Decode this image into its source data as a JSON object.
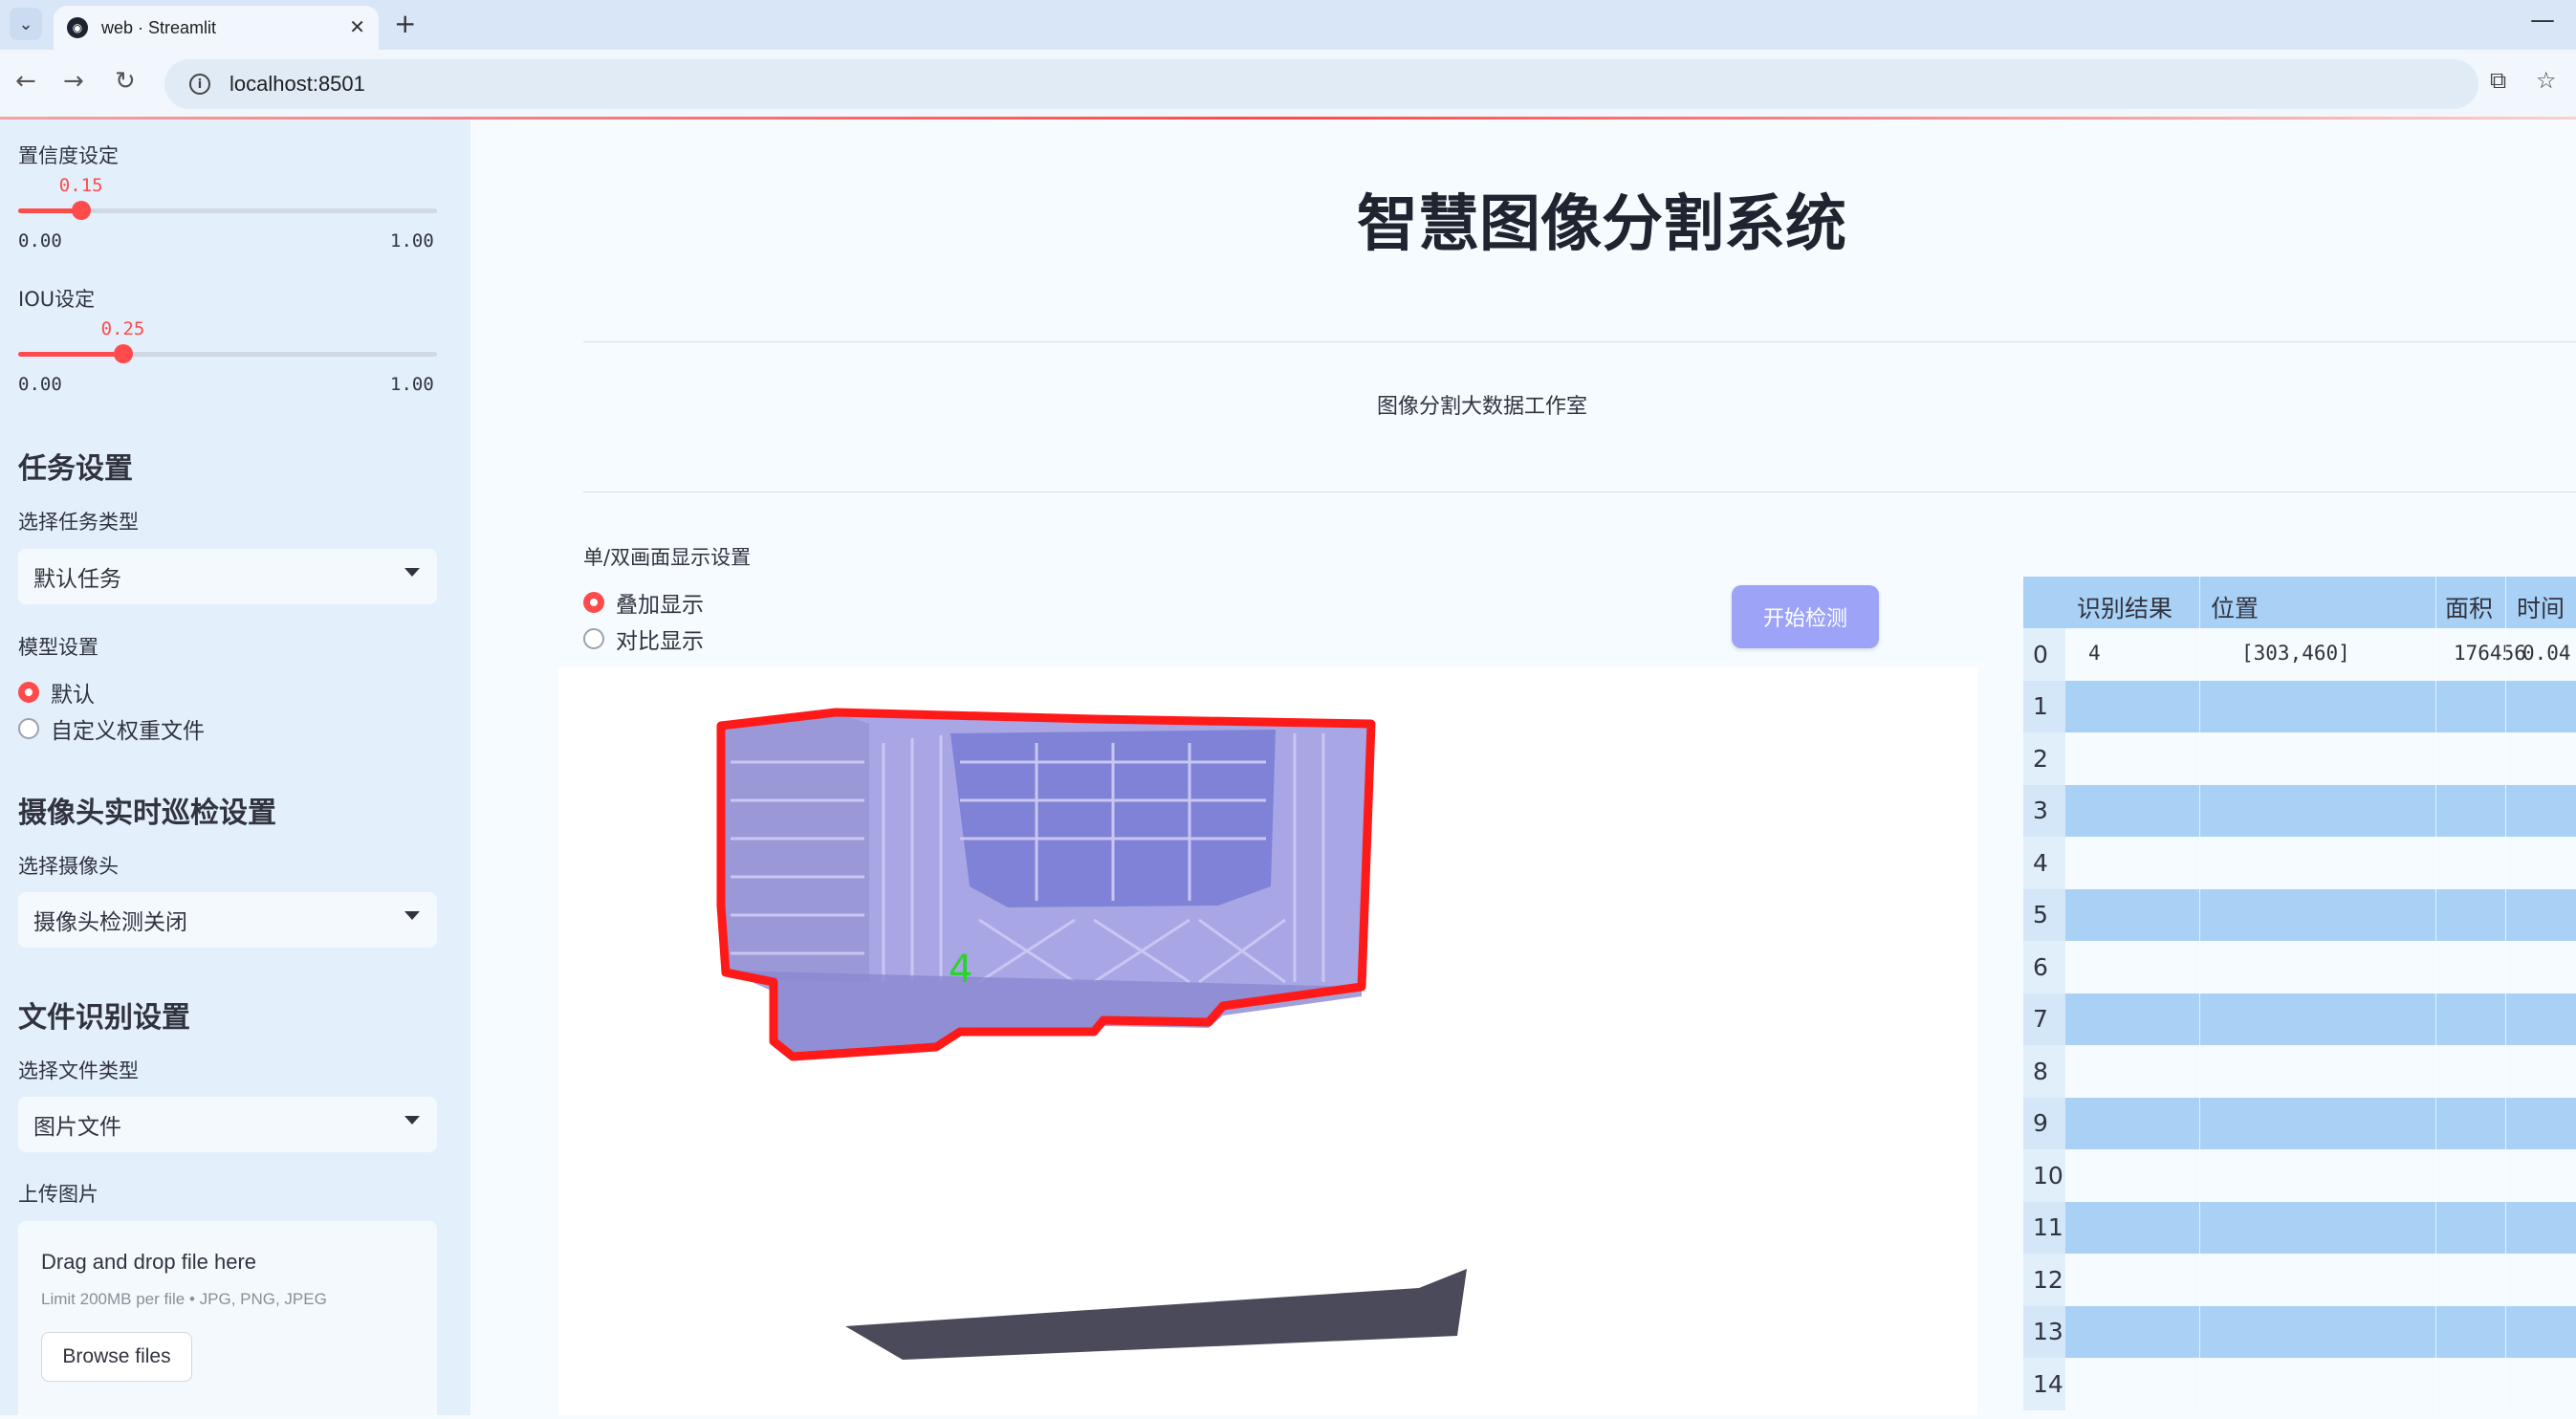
{
  "browser": {
    "tab_title": "web · Streamlit",
    "url": "localhost:8501"
  },
  "sidebar": {
    "confidence": {
      "label": "置信度设定",
      "value": 0.15,
      "value_text": "0.15",
      "min": "0.00",
      "max": "1.00"
    },
    "iou": {
      "label": "IOU设定",
      "value": 0.25,
      "value_text": "0.25",
      "min": "0.00",
      "max": "1.00"
    },
    "task_heading": "任务设置",
    "task_type_label": "选择任务类型",
    "task_type_value": "默认任务",
    "model_label": "模型设置",
    "model_options": [
      "默认",
      "自定义权重文件"
    ],
    "model_selected": "默认",
    "camera_heading": "摄像头实时巡检设置",
    "camera_label": "选择摄像头",
    "camera_value": "摄像头检测关闭",
    "file_heading": "文件识别设置",
    "file_type_label": "选择文件类型",
    "file_type_value": "图片文件",
    "upload_label": "上传图片",
    "upload": {
      "title": "Drag and drop file here",
      "limit": "Limit 200MB per file • JPG, PNG, JPEG",
      "button": "Browse files"
    }
  },
  "main": {
    "title": "智慧图像分割系统",
    "divider_text": "图像分割大数据工作室",
    "display_label": "单/双画面显示设置",
    "display_options": [
      "叠加显示",
      "对比显示"
    ],
    "display_selected": "叠加显示",
    "detect_button": "开始检测",
    "image": {
      "detection_label": "4"
    },
    "table": {
      "columns": [
        "识别结果",
        "位置",
        "面积",
        "时间"
      ],
      "row_indices": [
        "0",
        "1",
        "2",
        "3",
        "4",
        "5",
        "6",
        "7",
        "8",
        "9",
        "10",
        "11",
        "12",
        "13",
        "14"
      ],
      "rows": [
        {
          "result": "4",
          "position": "[303,460]",
          "area": "176456",
          "time": "0.04"
        }
      ]
    }
  }
}
